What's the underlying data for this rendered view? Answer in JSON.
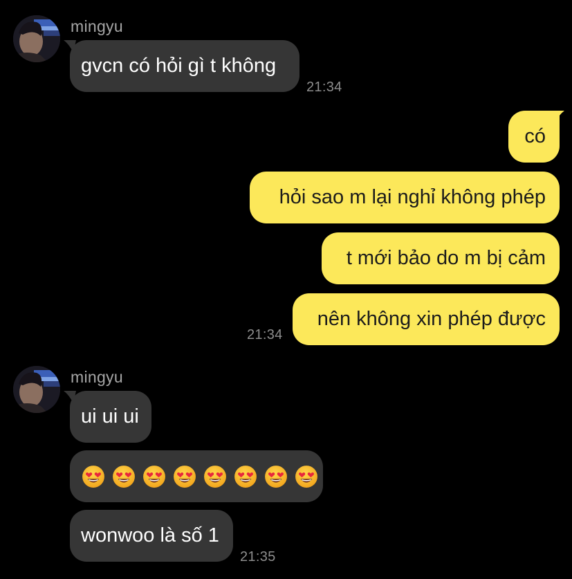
{
  "colors": {
    "background": "#000000",
    "incoming_bubble": "#363636",
    "outgoing_bubble": "#fce85a",
    "sender_name": "#a6a6a6",
    "timestamp": "#8e8e8e"
  },
  "groups": [
    {
      "sender": "mingyu",
      "messages": [
        {
          "text": "gvcn có hỏi gì t không"
        }
      ],
      "time": "21:34"
    },
    {
      "sender": "me",
      "messages": [
        {
          "text": "có"
        },
        {
          "text": "hỏi sao m lại nghỉ không phép"
        },
        {
          "text": "t mới bảo do m bị cảm"
        },
        {
          "text": "nên không xin phép được"
        }
      ],
      "time": "21:34"
    },
    {
      "sender": "mingyu",
      "messages": [
        {
          "text": "ui ui ui"
        },
        {
          "emoji_name": "smiling-face-with-heart-eyes",
          "count": 8
        },
        {
          "text": "wonwoo là số 1"
        }
      ],
      "time": "21:35"
    }
  ]
}
